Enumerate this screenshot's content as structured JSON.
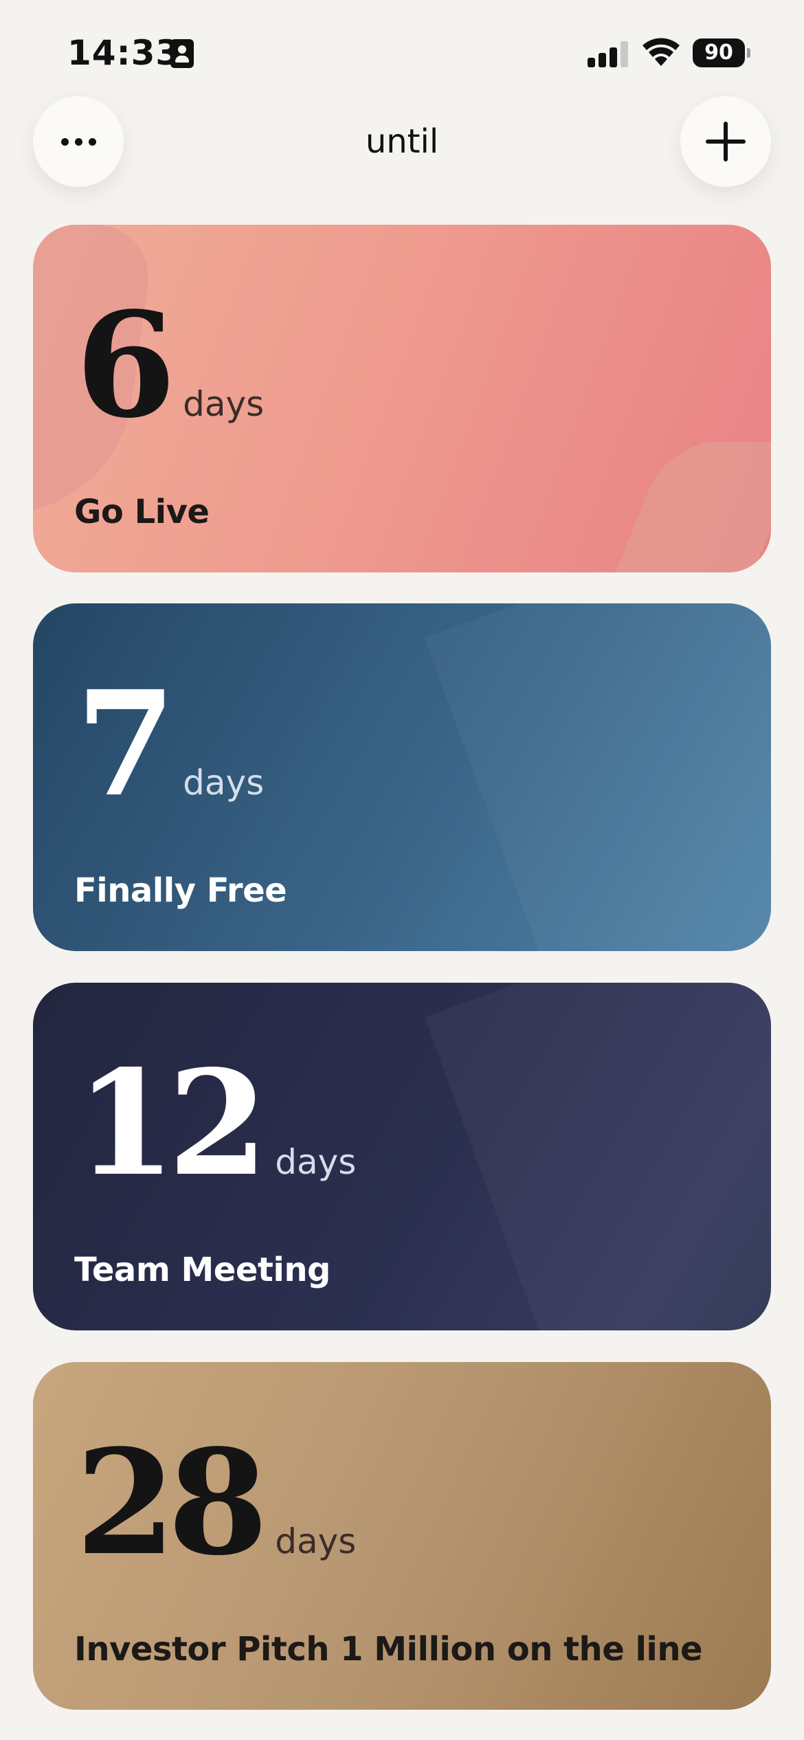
{
  "status_bar": {
    "time": "14:33",
    "battery": "90"
  },
  "header": {
    "title": "until",
    "more_icon": "ellipsis-icon",
    "add_icon": "plus-icon"
  },
  "countdowns": [
    {
      "count": "6",
      "unit": "days",
      "title": "Go Live",
      "color": "#ee9b8e"
    },
    {
      "count": "7",
      "unit": "days",
      "title": "Finally Free",
      "color": "#3b6689"
    },
    {
      "count": "12",
      "unit": "days",
      "title": "Team Meeting",
      "color": "#2c3050"
    },
    {
      "count": "28",
      "unit": "days",
      "title": "Investor Pitch 1 Million on the line",
      "color": "#b69671"
    }
  ]
}
